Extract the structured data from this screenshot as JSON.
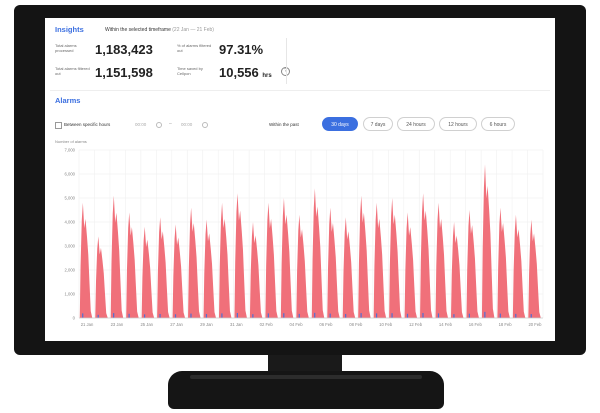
{
  "insights": {
    "title": "Insights",
    "timeframe_label": "Within the selected timeframe",
    "timeframe_dates": "(22 Jan — 21 Feb)",
    "stats": [
      {
        "label": "Total alarms processed",
        "value": "1,183,423"
      },
      {
        "label": "% of alarms filtered out",
        "value": "97.31%"
      },
      {
        "label": "Total alarms filtered out",
        "value": "1,151,598"
      },
      {
        "label": "Time saved by Cellpon",
        "value": "10,556",
        "unit": "hrs"
      }
    ],
    "help_icon": "question-circle-icon"
  },
  "alarms": {
    "title": "Alarms",
    "between_hours_label": "Between specific hours",
    "from_time": "00:00",
    "to_time": "00:00",
    "dash": "–",
    "within_label": "Within the past",
    "ranges": [
      "30 days",
      "7 days",
      "24 hours",
      "12 hours",
      "6 hours"
    ],
    "active_range": "30 days",
    "accent_color": "#3b6fe0"
  },
  "chart_data": {
    "type": "area",
    "ylabel": "Number of alarms",
    "ylim": [
      0,
      7000
    ],
    "yticks": [
      "7,000",
      "6,000",
      "5,000",
      "4,000",
      "3,000",
      "2,000",
      "1,000",
      "0"
    ],
    "x_tick_labels": [
      "21 Jan",
      "23 Jan",
      "25 Jan",
      "27 Jan",
      "29 Jan",
      "31 Jan",
      "02 Feb",
      "04 Feb",
      "06 Feb",
      "08 Feb",
      "10 Feb",
      "12 Feb",
      "14 Feb",
      "16 Feb",
      "18 Feb",
      "20 Feb"
    ],
    "series": [
      {
        "color": "#f0707a",
        "daily_peaks": [
          4800,
          3400,
          5100,
          4400,
          3800,
          4200,
          3900,
          4600,
          4100,
          4800,
          5200,
          4000,
          4800,
          5000,
          4300,
          5400,
          4600,
          4200,
          5100,
          4800,
          5000,
          4400,
          5200,
          4800,
          4000,
          4500,
          6400,
          4600,
          4300,
          4100
        ]
      },
      {
        "color": "#3b6fe0",
        "peak_ratio": 0.04
      }
    ],
    "grid": true
  }
}
